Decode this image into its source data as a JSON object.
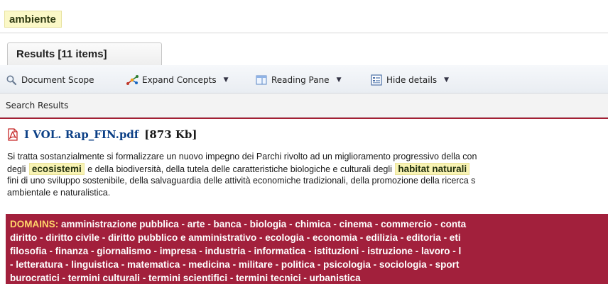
{
  "search": {
    "query": "ambiente"
  },
  "tab": {
    "label": "Results [11 items]"
  },
  "toolbar": {
    "document_scope": "Document Scope",
    "expand_concepts": "Expand Concepts",
    "reading_pane": "Reading Pane",
    "hide_details": "Hide details",
    "icons": [
      "magnifier-icon",
      "expand-concepts-icon",
      "reading-pane-icon",
      "details-icon",
      "dropdown-caret-icon"
    ]
  },
  "section": {
    "label": "Search Results"
  },
  "result": {
    "file_name": "I VOL. Rap_FIN.pdf",
    "file_size": "[873 Kb]",
    "snippet": {
      "line1": "Si tratta sostanzialmente si formalizzare un nuovo impegno dei Parchi rivolto ad un miglioramento progressivo della con",
      "line2_pre": "degli",
      "line2_hl1": "ecosistemi",
      "line2_mid": "e della biodiversità, della tutela delle caratteristiche biologiche e culturali degli",
      "line2_hl2": "habitat naturali",
      "line3": "fini di uno sviluppo sostenibile, della salvaguardia delle attività economiche tradizionali, della promozione della ricerca s",
      "line4": "ambientale e naturalistica."
    },
    "domains": {
      "key": "DOMAINS:",
      "line1": "amministrazione pubblica - arte - banca - biologia - chimica - cinema - commercio - conta",
      "line2": "diritto - diritto civile - diritto pubblico e amministrativo - ecologia - economia - edilizia - editoria - eti",
      "line3": "filosofia - finanza - giornalismo - impresa - industria - informatica - istituzioni - istruzione - lavoro - l",
      "line4": "- letteratura - linguistica - matematica - medicina - militare - politica - psicologia - sociologia - sport",
      "line5": "burocratici - termini culturali - termini scientifici - termini tecnici - urbanistica"
    }
  },
  "colors": {
    "accent_red": "#a2203c",
    "highlight": "#f8f3b3",
    "link_blue": "#0b3f86",
    "domain_key": "#ffd46a"
  }
}
